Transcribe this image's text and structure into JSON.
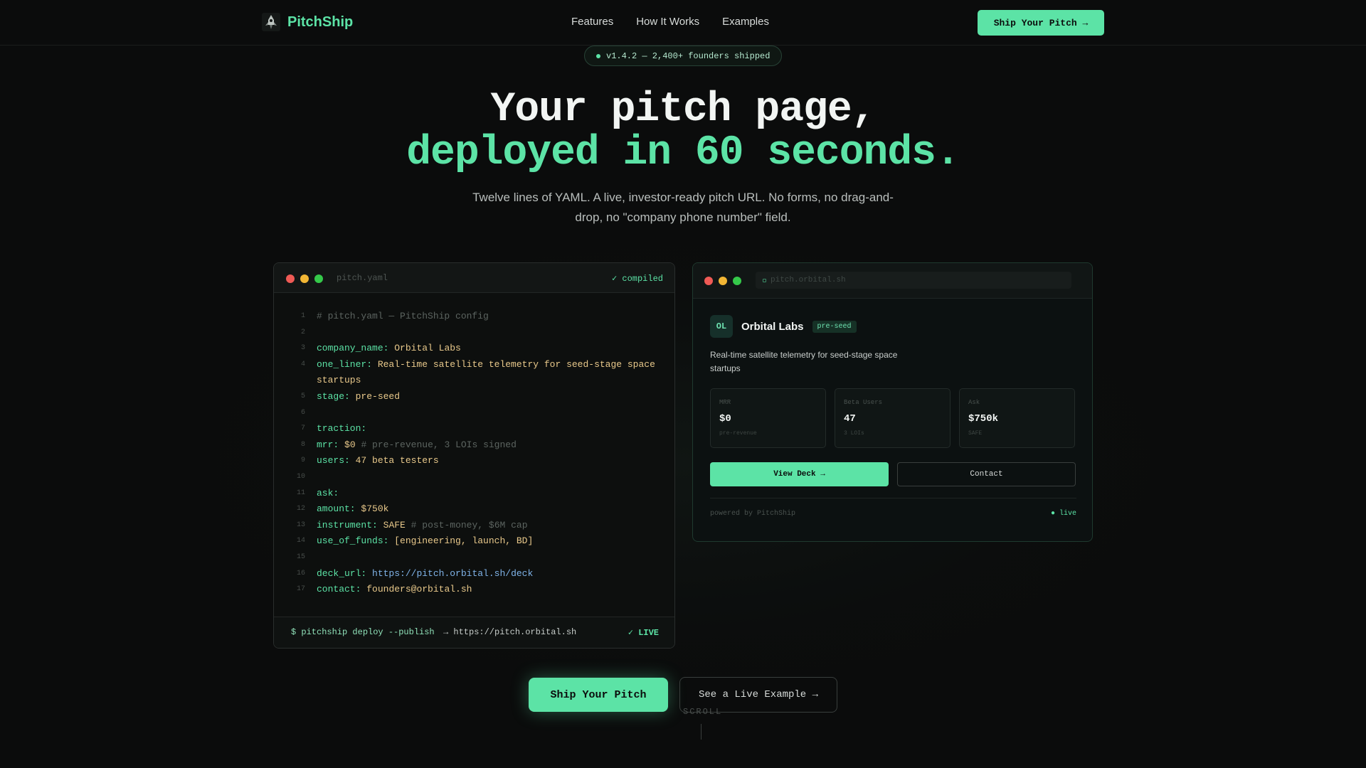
{
  "nav": {
    "brand": "PitchShip",
    "links": [
      "Features",
      "How It Works",
      "Examples"
    ],
    "cta": "Ship Your Pitch →"
  },
  "hero": {
    "badge": "v1.4.2 — 2,400+ founders shipped",
    "headline_line1": "Your pitch page,",
    "headline_line2": "deployed in 60 seconds.",
    "subtitle": "Twelve lines of YAML. A live, investor-ready pitch URL. No forms, no drag-and-drop, no \"company phone number\" field."
  },
  "editor": {
    "filename": "pitch.yaml",
    "status": "✓ compiled",
    "lines": [
      {
        "n": "1",
        "comment": "# pitch.yaml — PitchShip config"
      },
      {
        "n": "2"
      },
      {
        "n": "3",
        "key": "company_name:",
        "value": "Orbital Labs"
      },
      {
        "n": "4",
        "key": "one_liner:",
        "value": "Real-time satellite telemetry for seed-stage space"
      },
      {
        "n": "",
        "value": "startups"
      },
      {
        "n": "5",
        "key": "stage:",
        "value": "pre-seed"
      },
      {
        "n": "6"
      },
      {
        "n": "7",
        "key": "traction:"
      },
      {
        "n": "8",
        "key": "mrr:",
        "value": "$0",
        "comment": "# pre-revenue, 3 LOIs signed"
      },
      {
        "n": "9",
        "key": "users:",
        "value": "47 beta testers"
      },
      {
        "n": "10"
      },
      {
        "n": "11",
        "key": "ask:"
      },
      {
        "n": "12",
        "key": "amount:",
        "value": "$750k"
      },
      {
        "n": "13",
        "key": "instrument:",
        "value": "SAFE",
        "comment": "# post-money, $6M cap"
      },
      {
        "n": "14",
        "key": "use_of_funds:",
        "value": "[engineering, launch, BD]"
      },
      {
        "n": "15"
      },
      {
        "n": "16",
        "key": "deck_url:",
        "url": "https://pitch.orbital.sh/deck"
      },
      {
        "n": "17",
        "key": "contact:",
        "value": "founders@orbital.sh"
      }
    ],
    "footer": {
      "command": "$ pitchship deploy --publish",
      "result": "→ https://pitch.orbital.sh",
      "status": "✓ LIVE"
    }
  },
  "preview": {
    "url": "pitch.orbital.sh",
    "initials": "OL",
    "company": "Orbital Labs",
    "stage": "pre-seed",
    "description": "Real-time satellite telemetry for seed-stage space startups",
    "stats": [
      {
        "label": "MRR",
        "value": "$0",
        "note": "pre-revenue"
      },
      {
        "label": "Beta Users",
        "value": "47",
        "note": "3 LOIs"
      },
      {
        "label": "Ask",
        "value": "$750k",
        "note": "SAFE"
      }
    ],
    "primary_button": "View Deck →",
    "secondary_button": "Contact",
    "powered": "powered by PitchShip",
    "live": "● live"
  },
  "cta": {
    "primary": "Ship Your Pitch",
    "secondary": "See a Live Example →",
    "scroll": "SCROLL"
  },
  "colors": {
    "accent": "#5ce3a6",
    "background": "#0b0c0c",
    "key": "#5ce3a6",
    "value": "#e9c98b",
    "comment": "#5c6460",
    "url": "#7fb3e8"
  }
}
